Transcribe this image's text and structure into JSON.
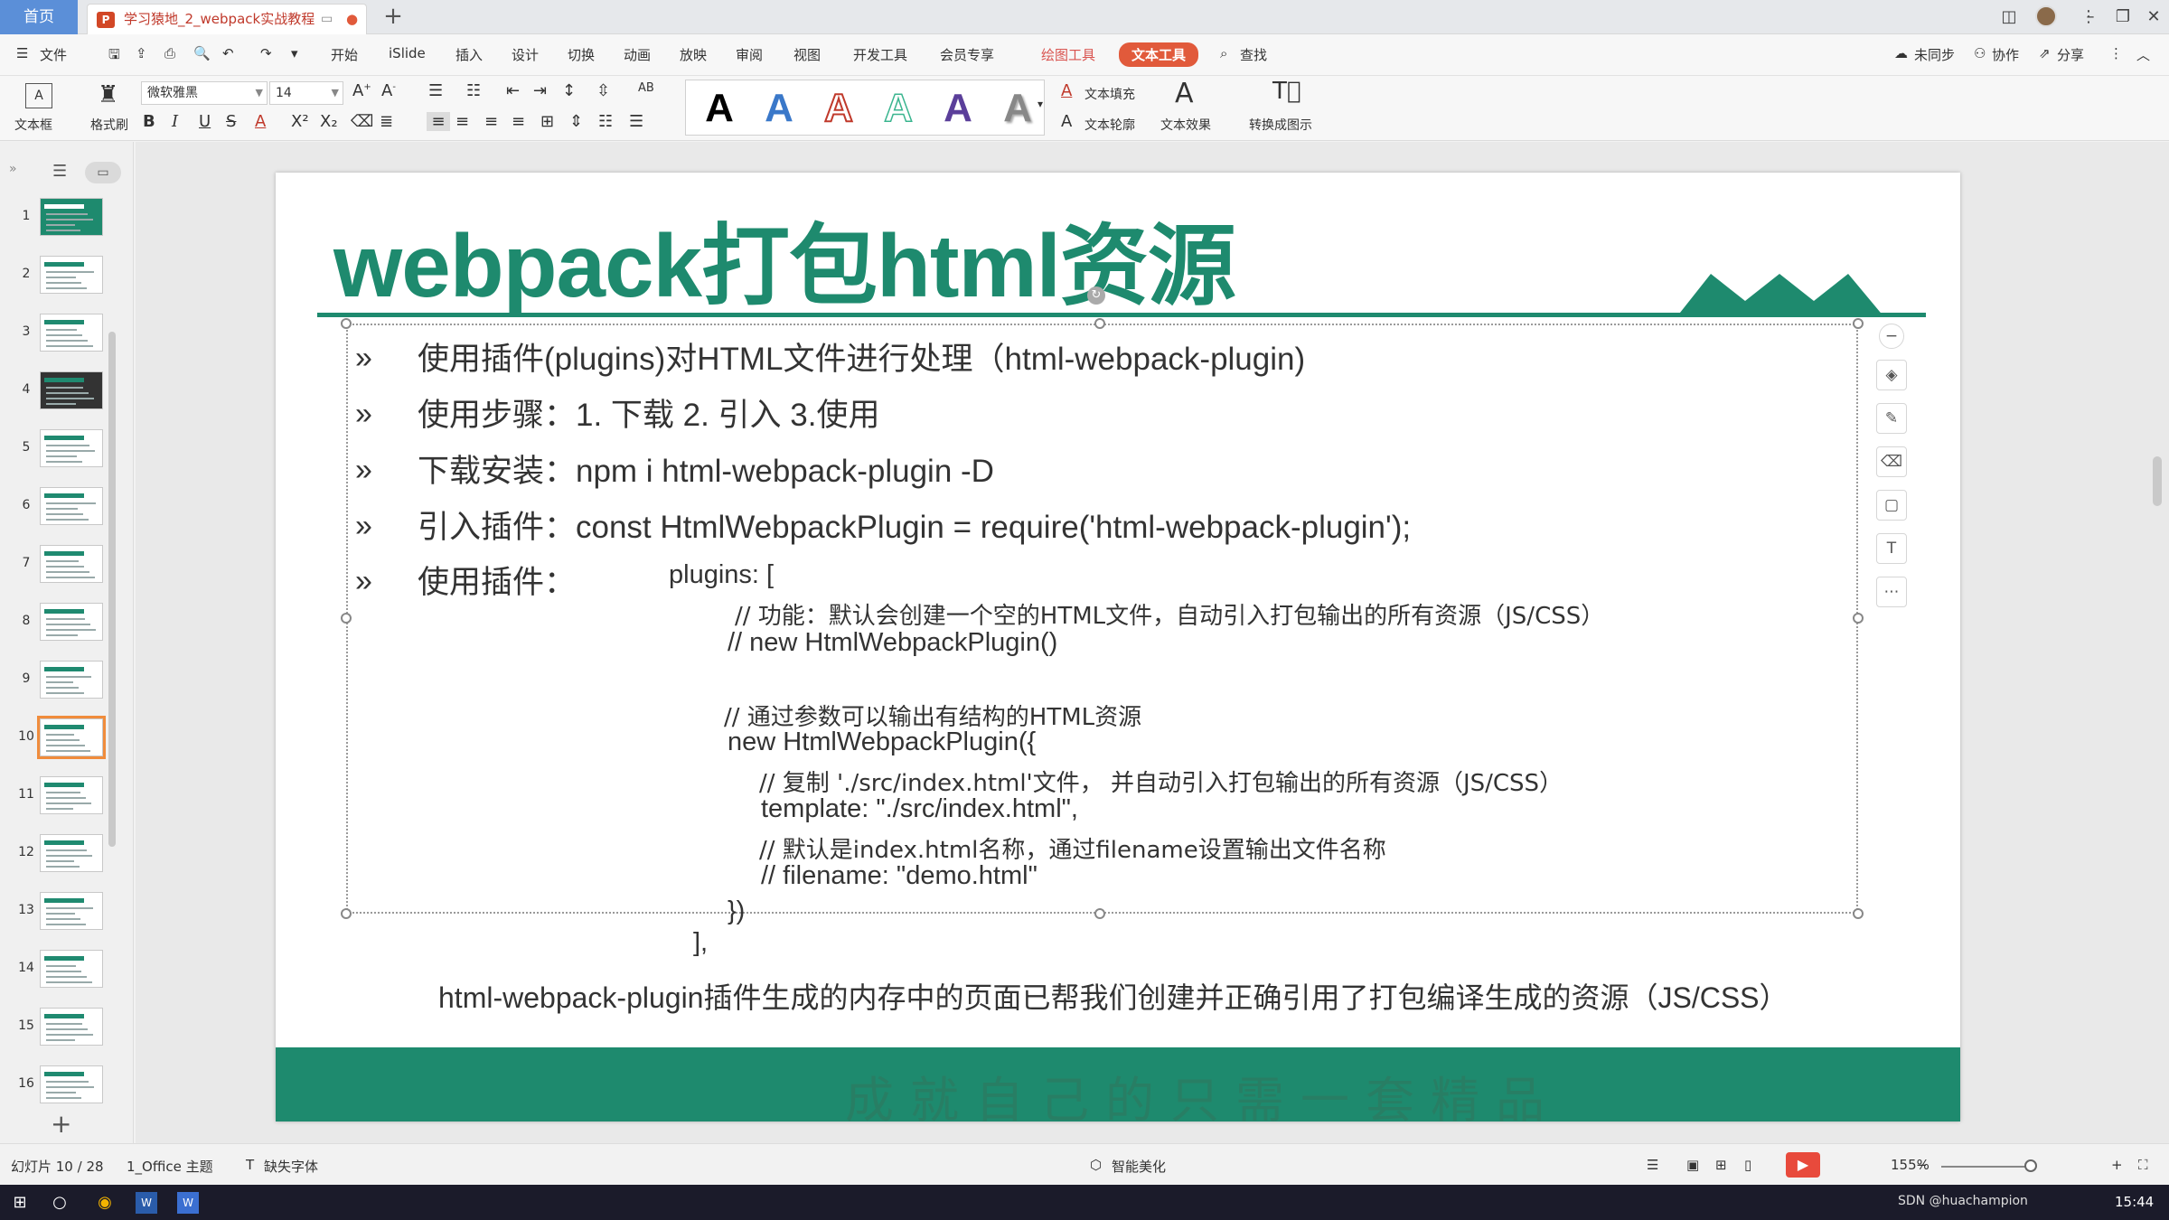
{
  "tabs": {
    "home": "首页",
    "document": "学习猿地_2_webpack实战教程"
  },
  "menu": {
    "file": "文件",
    "items": [
      "开始",
      "iSlide",
      "插入",
      "设计",
      "切换",
      "动画",
      "放映",
      "审阅",
      "视图",
      "开发工具",
      "会员专享"
    ],
    "draw_tools": "绘图工具",
    "text_tools": "文本工具",
    "search": "查找",
    "unsynced": "未同步",
    "collab": "协作",
    "share": "分享"
  },
  "ribbon": {
    "textbox": "文本框",
    "format_painter": "格式刷",
    "font_name": "微软雅黑",
    "font_size": "14",
    "text_fill": "文本填充",
    "text_outline": "文本轮廓",
    "text_effect": "文本效果",
    "convert_smartart": "转换成图示",
    "style_letters": [
      "A",
      "A",
      "A",
      "A",
      "A",
      "A"
    ]
  },
  "colors": {
    "accent_green": "#1e8a6e",
    "text_tools_tab": "#e15a3b",
    "selected_thumb_border": "#f08c3c"
  },
  "slides": {
    "numbers": [
      "1",
      "2",
      "3",
      "4",
      "5",
      "6",
      "7",
      "8",
      "9",
      "10",
      "11",
      "12",
      "13",
      "14",
      "15",
      "16"
    ],
    "selected": 10
  },
  "slide": {
    "title": "webpack打包html资源",
    "bullet_glyph": "»",
    "bullets": [
      "使用插件(plugins)对HTML文件进行处理（html-webpack-plugin)",
      "使用步骤：1. 下载 2. 引入        3.使用",
      "下载安装：npm i html-webpack-plugin -D",
      "引入插件：const HtmlWebpackPlugin = require('html-webpack-plugin');",
      "使用插件："
    ],
    "code": {
      "plugins_open": "plugins: [",
      "c1": "// 功能：默认会创建一个空的HTML文件，自动引入打包输出的所有资源（JS/CSS）",
      "c2": "// new HtmlWebpackPlugin()",
      "c3": "// 通过参数可以输出有结构的HTML资源",
      "new_open": "new HtmlWebpackPlugin({",
      "c4": "// 复制 './src/index.html'文件，  并自动引入打包输出的所有资源（JS/CSS）",
      "template": "template: \"./src/index.html\",",
      "c5": "// 默认是index.html名称，通过filename设置输出文件名称",
      "c6": "// filename: \"demo.html\"",
      "new_close": "})",
      "plugins_close": "],"
    },
    "footer_note": "html-webpack-plugin插件生成的内存中的页面已帮我们创建并正确引用了打包编译生成的资源（JS/CSS）",
    "band_text": "成就自己的只需一套精品"
  },
  "status": {
    "slide_pos": "幻灯片 10 / 28",
    "theme": "1_Office 主题",
    "missing_font": "缺失字体",
    "smart_beautify": "智能美化",
    "zoom": "155%"
  },
  "taskbar": {
    "tray": "SDN @huachampion",
    "time": "15:44"
  }
}
